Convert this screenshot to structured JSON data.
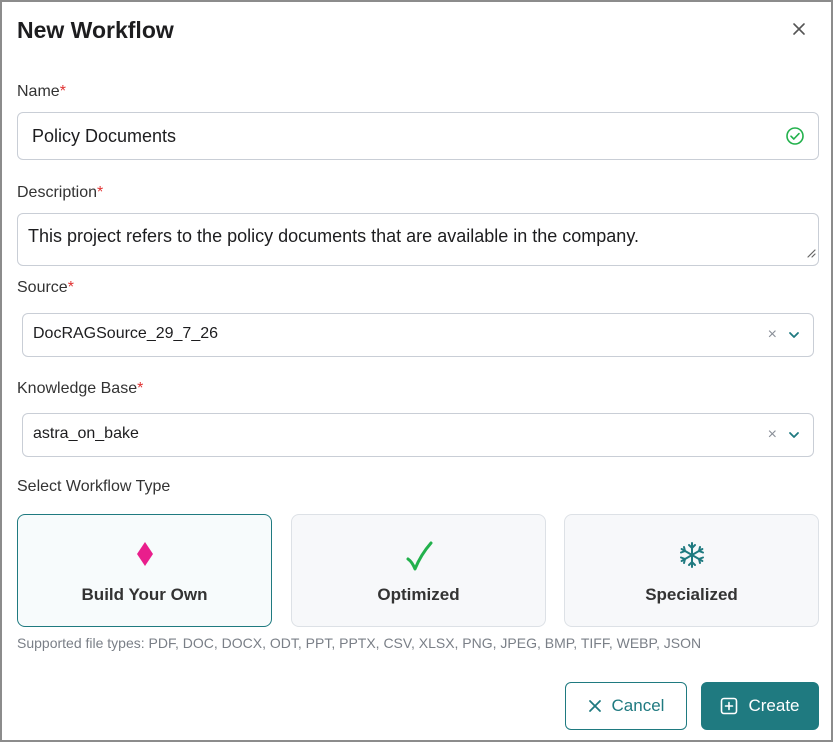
{
  "dialog": {
    "title": "New Workflow",
    "close_icon": "close-icon"
  },
  "form": {
    "name": {
      "label": "Name",
      "required": "*",
      "value": "Policy Documents",
      "status_icon": "check-circle-icon"
    },
    "description": {
      "label": "Description",
      "required": "*",
      "value": "This project refers to the policy documents that are available in the company."
    },
    "source": {
      "label": "Source",
      "required": "*",
      "value": "DocRAGSource_29_7_26",
      "clear": "×"
    },
    "knowledge_base": {
      "label": "Knowledge Base",
      "required": "*",
      "value": "astra_on_bake",
      "clear": "×"
    },
    "workflow_type": {
      "label": "Select Workflow Type",
      "selected": "Build Your Own",
      "options": [
        {
          "label": "Build Your Own",
          "icon": "diamond-icon"
        },
        {
          "label": "Optimized",
          "icon": "checkmark-icon"
        },
        {
          "label": "Specialized",
          "icon": "snowflake-icon"
        }
      ]
    },
    "supported_types": "Supported file types: PDF, DOC, DOCX, ODT, PPT, PPTX, CSV, XLSX, PNG, JPEG, BMP, TIFF, WEBP, JSON"
  },
  "actions": {
    "cancel_label": "Cancel",
    "create_label": "Create"
  },
  "colors": {
    "accent": "#1f7a80",
    "required": "#e03131",
    "success": "#22b14c",
    "diamond": "#e91e8c"
  }
}
